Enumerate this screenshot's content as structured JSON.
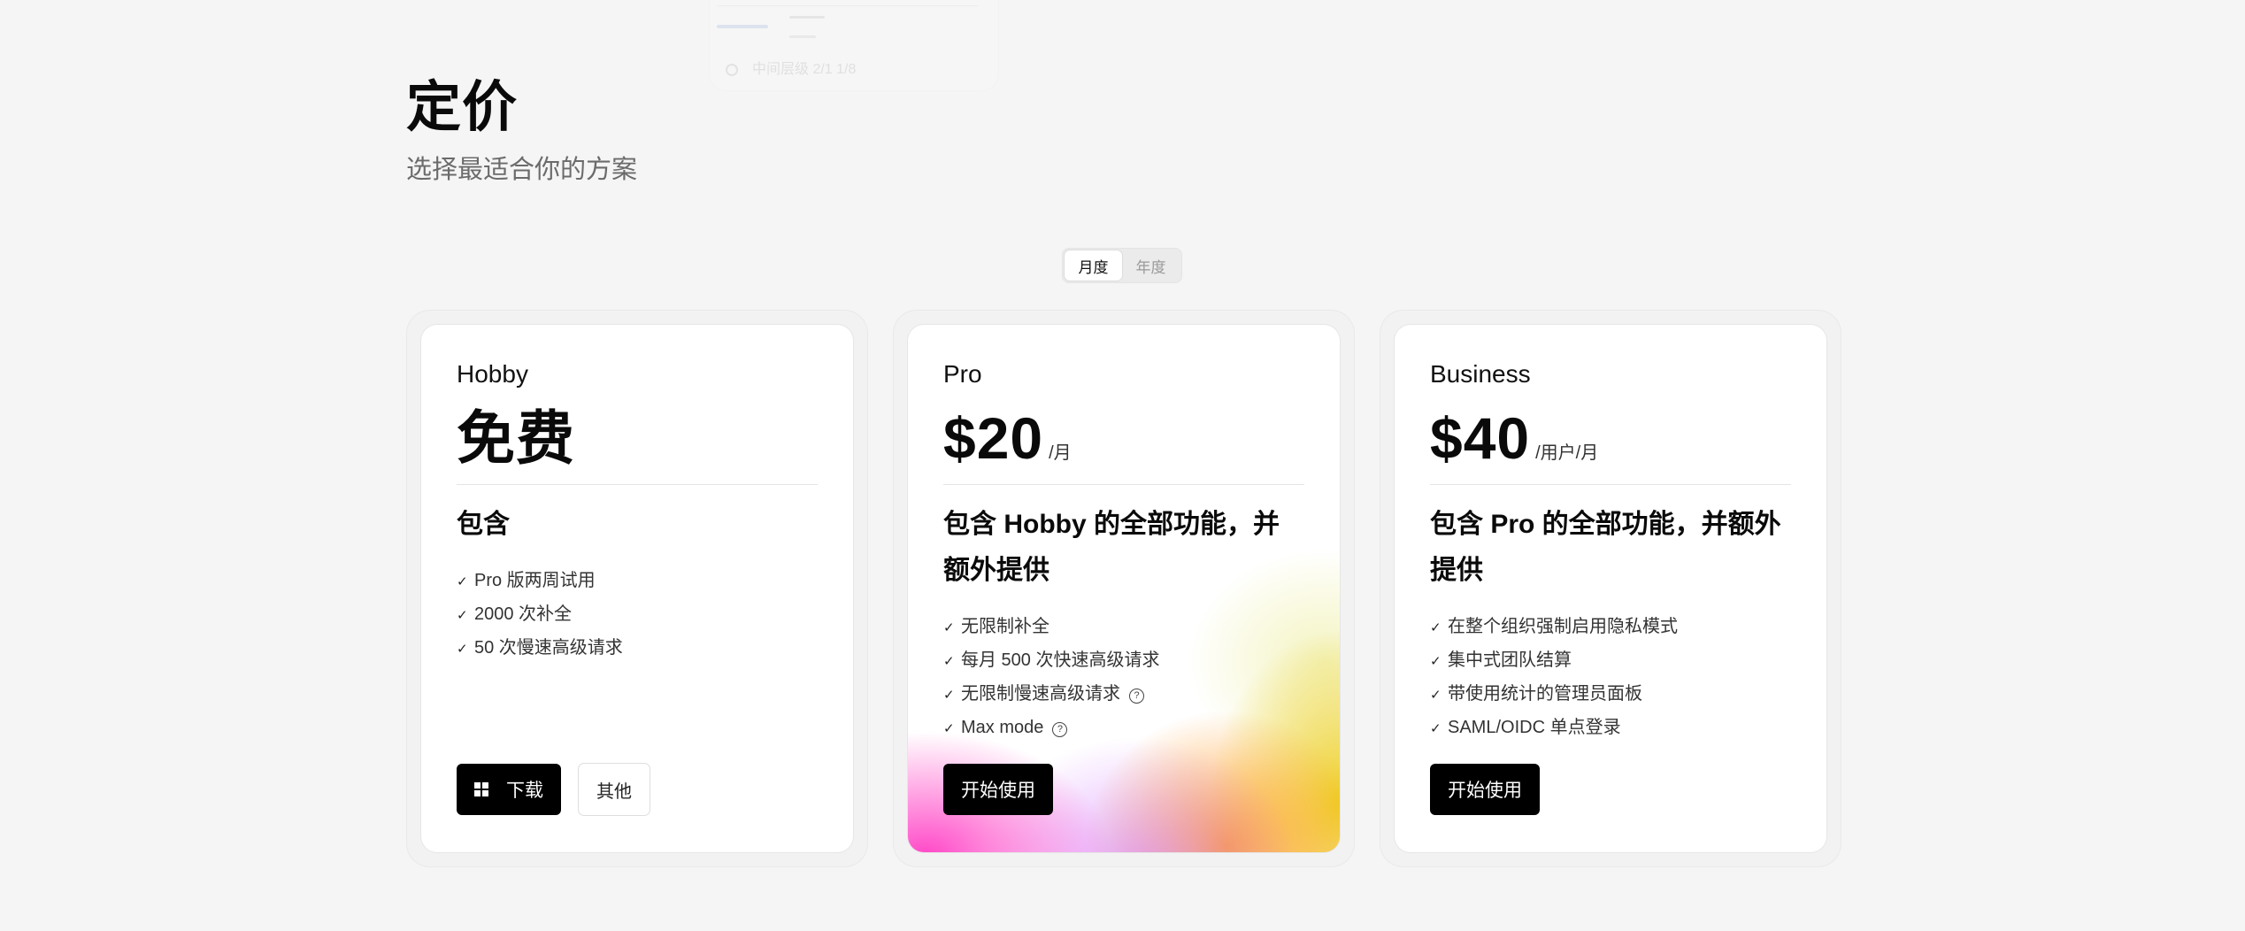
{
  "ghost": {
    "footer_text": "中间层级 2/1 1/8"
  },
  "header": {
    "title": "定价",
    "subtitle": "选择最适合你的方案"
  },
  "billing_toggle": {
    "monthly": "月度",
    "yearly": "年度",
    "selected": "monthly"
  },
  "plans": [
    {
      "name": "Hobby",
      "price": "免费",
      "unit": "",
      "includes": "包含",
      "features": [
        "Pro 版两周试用",
        "2000 次补全",
        "50 次慢速高级请求"
      ],
      "buttons": {
        "primary": "下载",
        "secondary": "其他"
      }
    },
    {
      "name": "Pro",
      "price": "$20",
      "unit": "/月",
      "includes": "包含 Hobby 的全部功能，并额外提供",
      "features": [
        "无限制补全",
        "每月 500 次快速高级请求",
        "无限制慢速高级请求",
        "Max mode"
      ],
      "help_icon": "?",
      "buttons": {
        "primary": "开始使用"
      }
    },
    {
      "name": "Business",
      "price": "$40",
      "unit": "/用户/月",
      "includes": "包含 Pro 的全部功能，并额外提供",
      "features": [
        "在整个组织强制启用隐私模式",
        "集中式团队结算",
        "带使用统计的管理员面板",
        "SAML/OIDC 单点登录"
      ],
      "buttons": {
        "primary": "开始使用"
      }
    }
  ],
  "icons": {
    "check": "✓",
    "download_button_icon": "windows-icon",
    "feature_help": "question-circle-icon"
  },
  "colors": {
    "background": "#f5f5f5",
    "primary_button": "#000000",
    "pro_gradient": [
      "#ff3ec4",
      "#d278ff",
      "#ff9e2e",
      "#eccc14"
    ]
  }
}
